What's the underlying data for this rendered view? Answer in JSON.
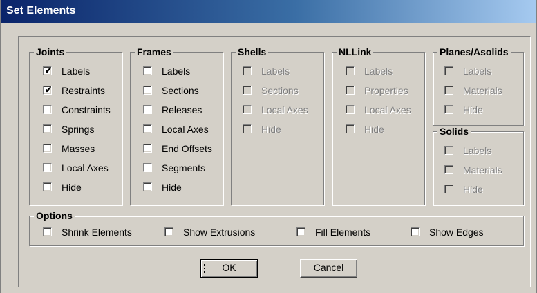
{
  "window": {
    "title": "Set Elements"
  },
  "groups": {
    "joints": {
      "title": "Joints",
      "items": [
        {
          "label": "Labels",
          "checked": true,
          "enabled": true
        },
        {
          "label": "Restraints",
          "checked": true,
          "enabled": true
        },
        {
          "label": "Constraints",
          "checked": false,
          "enabled": true
        },
        {
          "label": "Springs",
          "checked": false,
          "enabled": true
        },
        {
          "label": "Masses",
          "checked": false,
          "enabled": true
        },
        {
          "label": "Local Axes",
          "checked": false,
          "enabled": true
        },
        {
          "label": "Hide",
          "checked": false,
          "enabled": true
        }
      ]
    },
    "frames": {
      "title": "Frames",
      "items": [
        {
          "label": "Labels",
          "checked": false,
          "enabled": true
        },
        {
          "label": "Sections",
          "checked": false,
          "enabled": true
        },
        {
          "label": "Releases",
          "checked": false,
          "enabled": true
        },
        {
          "label": "Local Axes",
          "checked": false,
          "enabled": true
        },
        {
          "label": "End Offsets",
          "checked": false,
          "enabled": true
        },
        {
          "label": "Segments",
          "checked": false,
          "enabled": true
        },
        {
          "label": "Hide",
          "checked": false,
          "enabled": true
        }
      ]
    },
    "shells": {
      "title": "Shells",
      "items": [
        {
          "label": "Labels",
          "checked": false,
          "enabled": false
        },
        {
          "label": "Sections",
          "checked": false,
          "enabled": false
        },
        {
          "label": "Local Axes",
          "checked": false,
          "enabled": false
        },
        {
          "label": "Hide",
          "checked": false,
          "enabled": false
        }
      ]
    },
    "nllink": {
      "title": "NLLink",
      "items": [
        {
          "label": "Labels",
          "checked": false,
          "enabled": false
        },
        {
          "label": "Properties",
          "checked": false,
          "enabled": false
        },
        {
          "label": "Local Axes",
          "checked": false,
          "enabled": false
        },
        {
          "label": "Hide",
          "checked": false,
          "enabled": false
        }
      ]
    },
    "planes": {
      "title": "Planes/Asolids",
      "items": [
        {
          "label": "Labels",
          "checked": false,
          "enabled": false
        },
        {
          "label": "Materials",
          "checked": false,
          "enabled": false
        },
        {
          "label": "Hide",
          "checked": false,
          "enabled": false
        }
      ]
    },
    "solids": {
      "title": "Solids",
      "items": [
        {
          "label": "Labels",
          "checked": false,
          "enabled": false
        },
        {
          "label": "Materials",
          "checked": false,
          "enabled": false
        },
        {
          "label": "Hide",
          "checked": false,
          "enabled": false
        }
      ]
    },
    "options": {
      "title": "Options",
      "items": [
        {
          "label": "Shrink Elements",
          "checked": false,
          "enabled": true
        },
        {
          "label": "Show Extrusions",
          "checked": false,
          "enabled": true
        },
        {
          "label": "Fill Elements",
          "checked": false,
          "enabled": true
        },
        {
          "label": "Show Edges",
          "checked": false,
          "enabled": true
        }
      ]
    }
  },
  "buttons": {
    "ok": "OK",
    "cancel": "Cancel"
  },
  "colors": {
    "dialog_face": "#d4d0c8",
    "title_start": "#0a246a",
    "title_end": "#a6caf0",
    "disabled_text": "#808080"
  }
}
